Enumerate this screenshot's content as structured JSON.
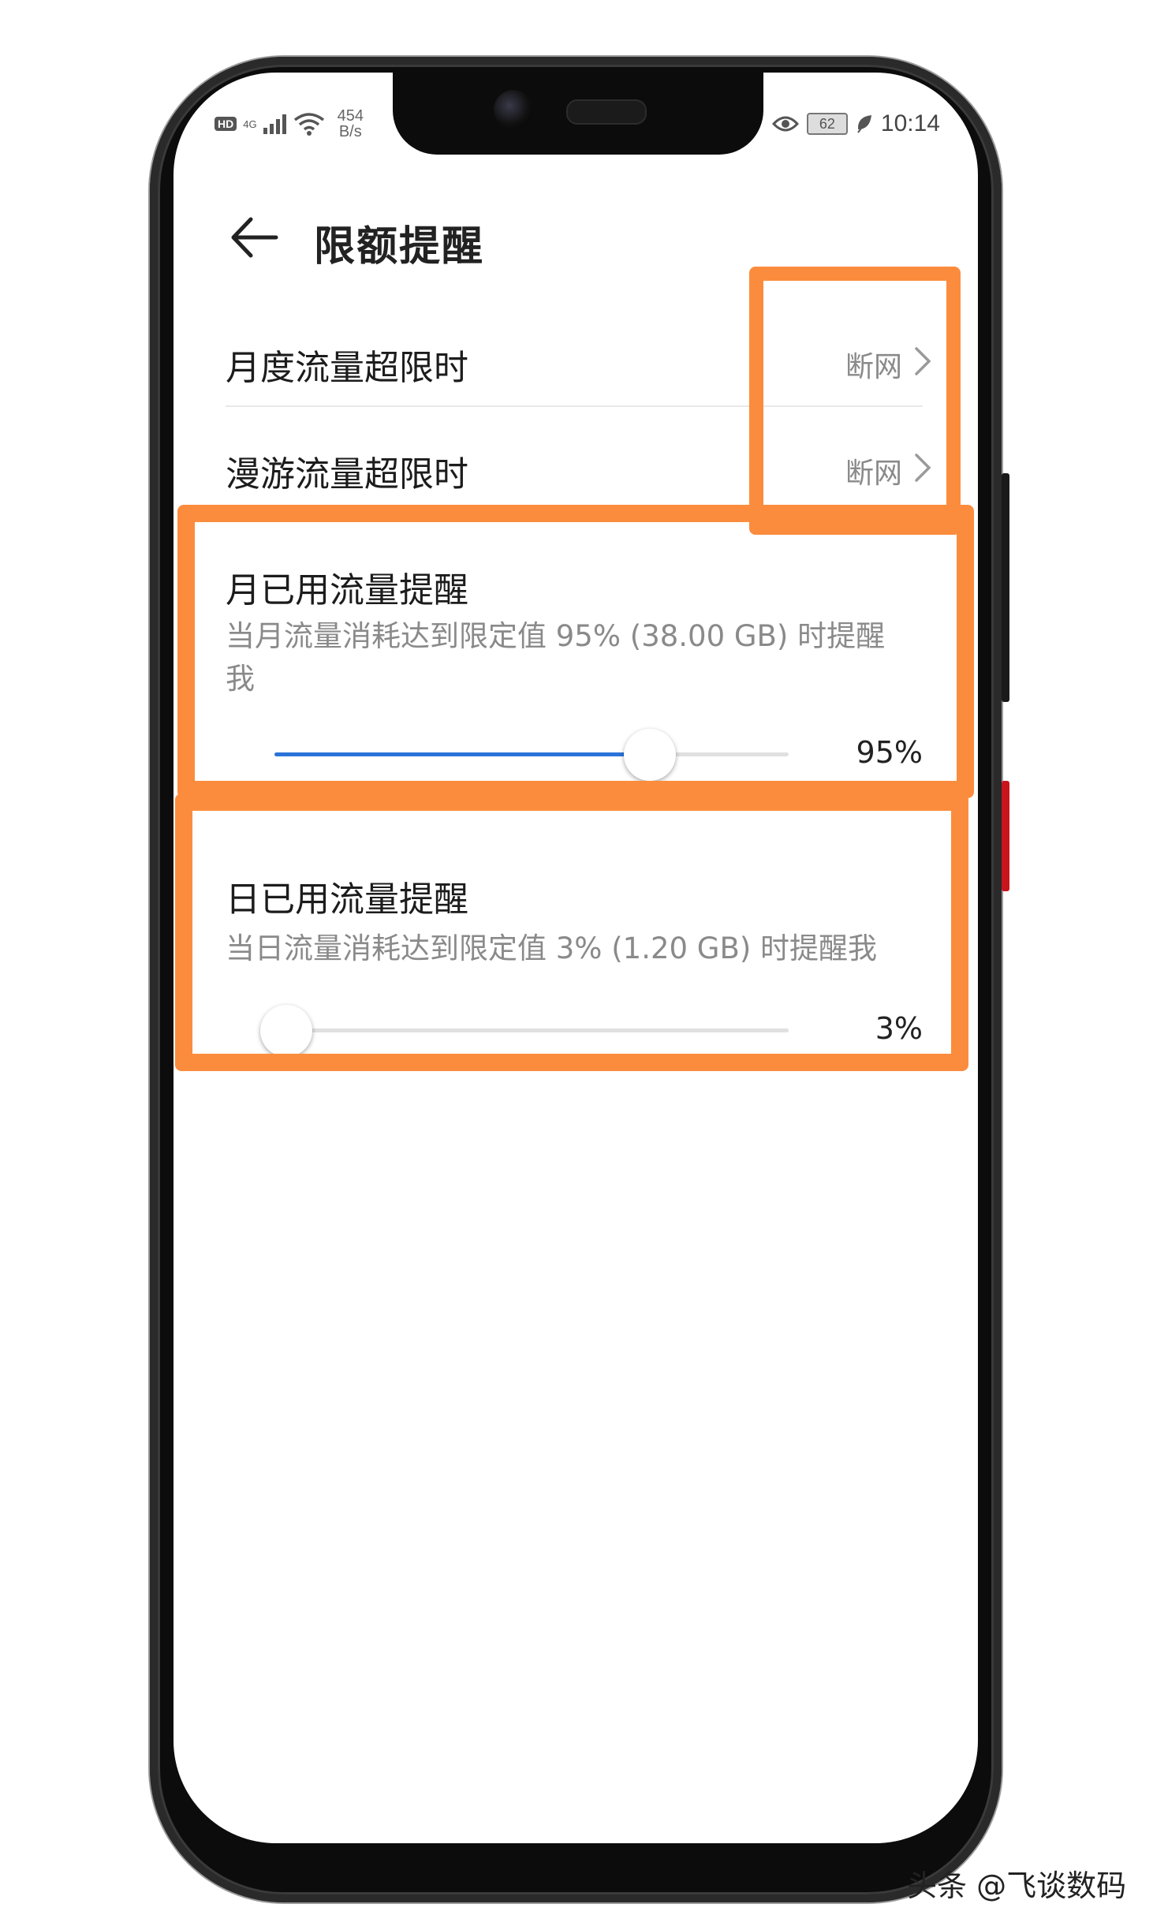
{
  "status_bar": {
    "hd": "HD",
    "network": "4G",
    "speed_value": "454",
    "speed_unit": "B/s",
    "battery": "62",
    "time": "10:14"
  },
  "header": {
    "title": "限额提醒"
  },
  "rows": [
    {
      "label": "月度流量超限时",
      "value": "断网"
    },
    {
      "label": "漫游流量超限时",
      "value": "断网"
    }
  ],
  "monthly": {
    "title": "月已用流量提醒",
    "desc_line1": "当月流量消耗达到限定值 95% (38.00 GB) 时提醒",
    "desc_line2": "我",
    "percent_label": "95%",
    "value": 0.95
  },
  "daily": {
    "title": "日已用流量提醒",
    "desc": "当日流量消耗达到限定值 3% (1.20 GB) 时提醒我",
    "percent_label": "3%",
    "value": 0.03
  },
  "colors": {
    "accent": "#2a73d9",
    "highlight": "#fb8c3d"
  },
  "watermark": "头条 @飞谈数码"
}
